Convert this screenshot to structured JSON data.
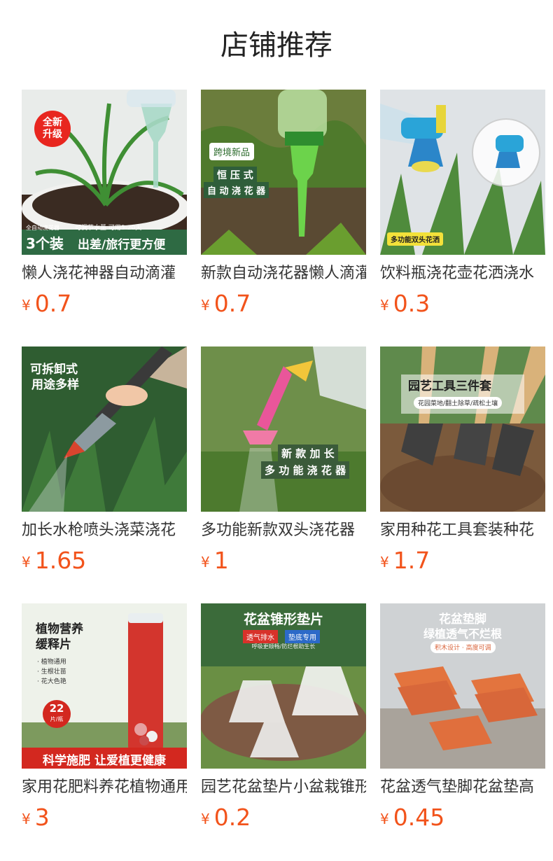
{
  "header": {
    "title": "店铺推荐"
  },
  "products": [
    {
      "name": "懒人浇花神器自动滴灌",
      "currency": "¥",
      "price": "0.7",
      "overlay": {
        "badge": "全新\n升级",
        "small": "全自动浇花器",
        "count": "3个装",
        "tip": "可调节水量 可用5-20天",
        "slogan": "出差/旅行更方便"
      }
    },
    {
      "name": "新款自动浇花器懒人滴灌",
      "currency": "¥",
      "price": "0.7",
      "overlay": {
        "tag": "跨境新品",
        "line1": "恒 压 式",
        "line2": "自 动 浇 花 器"
      }
    },
    {
      "name": "饮料瓶浇花壶花洒浇水",
      "currency": "¥",
      "price": "0.3",
      "overlay": {
        "tag": "多功能双头花洒"
      }
    },
    {
      "name": "加长水枪喷头浇菜浇花",
      "currency": "¥",
      "price": "1.65",
      "overlay": {
        "line1": "可拆卸式",
        "line2": "用途多样"
      }
    },
    {
      "name": "多功能新款双头浇花器",
      "currency": "¥",
      "price": "1",
      "overlay": {
        "line1": "新 款 加 长",
        "line2": "多 功 能 浇 花 器"
      }
    },
    {
      "name": "家用种花工具套装种花",
      "currency": "¥",
      "price": "1.7",
      "overlay": {
        "title": "园艺工具三件套",
        "sub": "花园菜地/翻土除草/疏松土壤"
      }
    },
    {
      "name": "家用花肥料养花植物通用",
      "currency": "¥",
      "price": "3",
      "overlay": {
        "title1": "植物营养",
        "title2": "缓释片",
        "b1": "· 植物通用",
        "b2": "· 生根壮苗",
        "b3": "· 花大色艳",
        "count": "22",
        "unit": "片/瓶",
        "banner": "科学施肥 让爱植更健康"
      }
    },
    {
      "name": "园艺花盆垫片小盆栽锥形",
      "currency": "¥",
      "price": "0.2",
      "overlay": {
        "title": "花盆锥形垫片",
        "tag1": "透气排水",
        "tag2": "垫底专用",
        "sub": "呼吸更顺畅/防烂根助生长"
      }
    },
    {
      "name": "花盆透气垫脚花盆垫高",
      "currency": "¥",
      "price": "0.45",
      "overlay": {
        "title1": "花盆垫脚",
        "title2": "绿植透气不烂根",
        "tag": "积木设计 · 高度可调"
      }
    }
  ]
}
